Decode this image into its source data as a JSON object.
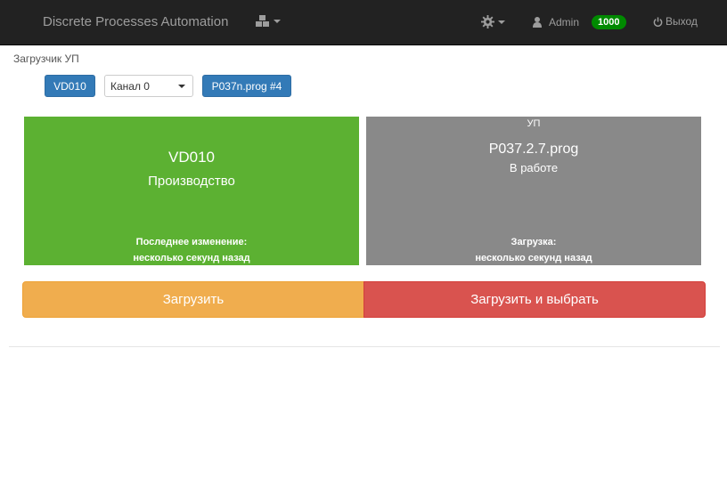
{
  "navbar": {
    "brand": "Discrete Processes Automation",
    "user": "Admin",
    "badge": "1000",
    "logout": "Выход"
  },
  "page": {
    "section_title": "Загрузчик УП"
  },
  "toolbar": {
    "machine_button": "VD010",
    "channel_select": "Канал 0",
    "program_button": "P037n.prog #4"
  },
  "left_panel": {
    "machine": "VD010",
    "state": "Производство",
    "last_change_label": "Последнее изменение:",
    "last_change_value": "несколько секунд назад",
    "color": "#5cb132"
  },
  "right_panel": {
    "header": "УП",
    "program": "P037.2.7.prog",
    "status": "В работе",
    "load_label": "Загрузка:",
    "load_value": "несколько секунд назад",
    "color": "#898989"
  },
  "actions": {
    "load": "Загрузить",
    "load_and_select": "Загрузить и выбрать"
  },
  "icons": {
    "modules": "cubes-icon",
    "settings": "gear-icon",
    "user": "user-icon",
    "logout": "power-icon"
  }
}
